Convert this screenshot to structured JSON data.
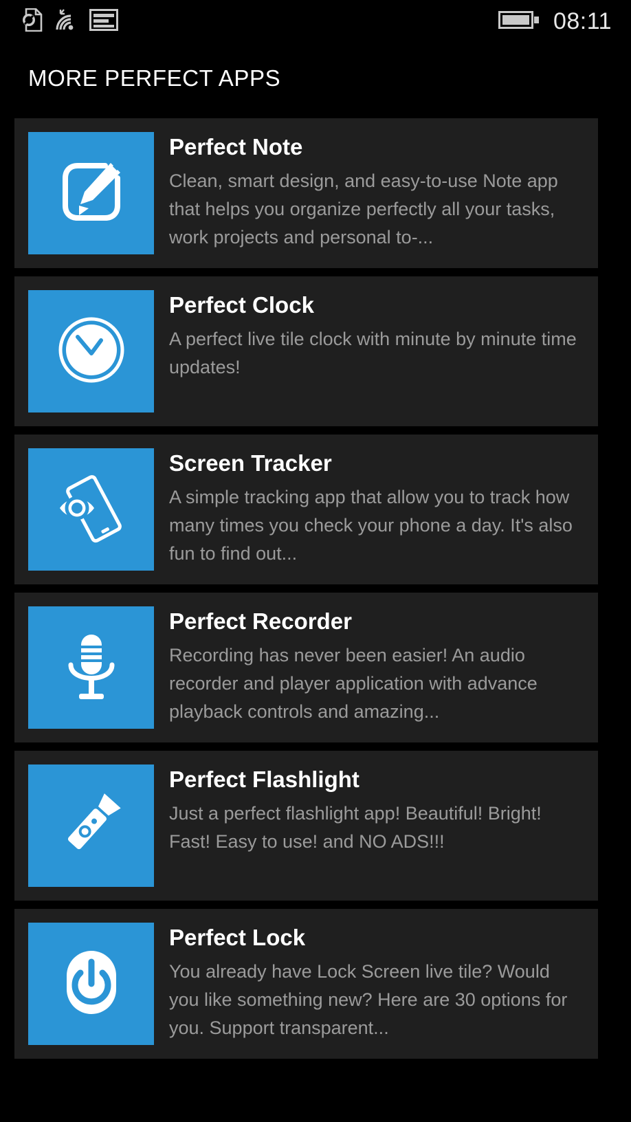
{
  "status_bar": {
    "icons": [
      {
        "name": "no-sim-icon",
        "label": "No SIM"
      },
      {
        "name": "wifi-icon",
        "label": "Wi-Fi signal"
      },
      {
        "name": "cellular-data-icon",
        "label": "Mobile data"
      }
    ],
    "battery": {
      "name": "battery-full-icon",
      "label": "Battery full"
    },
    "time": "08:11"
  },
  "header": {
    "title": "MORE PERFECT APPS"
  },
  "colors": {
    "accent": "#2b95d6",
    "card_background": "#1f1f1f",
    "page_background": "#000000",
    "title_text": "#ffffff",
    "description_text": "#9b9b9b"
  },
  "apps": [
    {
      "name": "Perfect Note",
      "description": "Clean, smart design, and easy-to-use Note app that helps you organize perfectly all your tasks, work projects and personal to-...",
      "icon": "note-pencil-icon"
    },
    {
      "name": "Perfect Clock",
      "description": "A perfect live tile clock with minute by minute time updates!",
      "icon": "clock-icon"
    },
    {
      "name": "Screen Tracker",
      "description": "A simple tracking app that allow you to track how many times you check your phone a day. It's also fun to find out...",
      "icon": "eye-phone-icon"
    },
    {
      "name": "Perfect Recorder",
      "description": "Recording has never been easier! An audio recorder and player application with advance playback controls and amazing...",
      "icon": "microphone-icon"
    },
    {
      "name": "Perfect Flashlight",
      "description": "Just a perfect flashlight app! Beautiful! Bright! Fast! Easy to use! and NO ADS!!!",
      "icon": "flashlight-icon"
    },
    {
      "name": "Perfect Lock",
      "description": "You already have Lock Screen live tile? Would you like something new? Here are 30 options for you. Support transparent...",
      "icon": "power-lock-icon"
    }
  ]
}
